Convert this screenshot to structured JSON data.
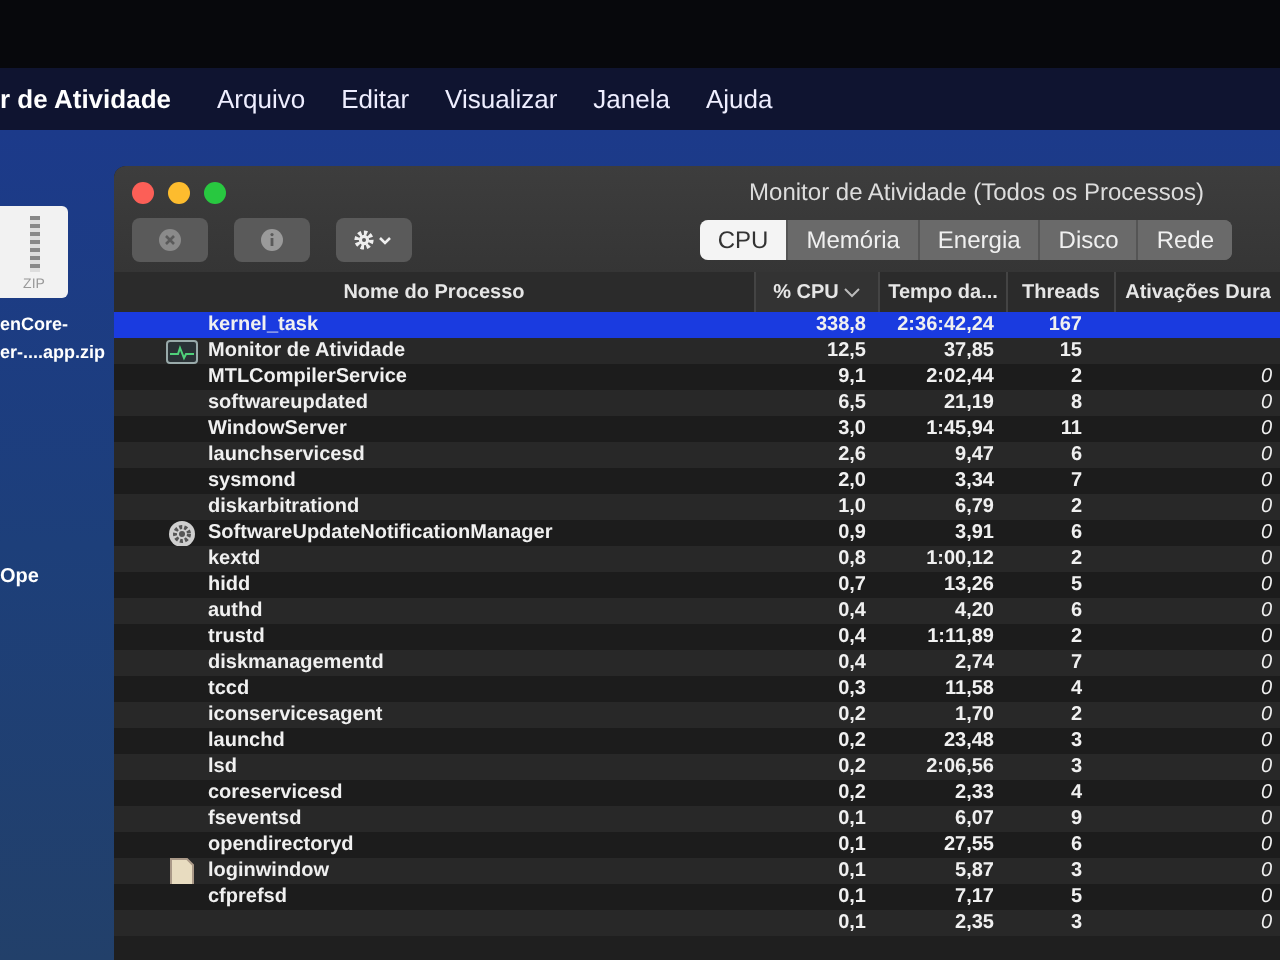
{
  "menu_bar": {
    "app_name": "r de Atividade",
    "items": [
      "Arquivo",
      "Editar",
      "Visualizar",
      "Janela",
      "Ajuda"
    ]
  },
  "desktop": {
    "file": {
      "badge": "ZIP",
      "name_lines": [
        "enCore-",
        "er-....app.zip"
      ]
    },
    "label": "Ope"
  },
  "window": {
    "title": "Monitor de Atividade (Todos os Processos)",
    "tabs": [
      {
        "label": "CPU",
        "selected": true
      },
      {
        "label": "Memória",
        "selected": false
      },
      {
        "label": "Energia",
        "selected": false
      },
      {
        "label": "Disco",
        "selected": false
      },
      {
        "label": "Rede",
        "selected": false
      }
    ],
    "columns": [
      {
        "label": "Nome do Processo",
        "sorted": false
      },
      {
        "label": "% CPU",
        "sorted": true
      },
      {
        "label": "Tempo da...",
        "sorted": false
      },
      {
        "label": "Threads",
        "sorted": false
      },
      {
        "label": "Ativações Dura",
        "sorted": false
      }
    ],
    "processes": [
      {
        "name": "kernel_task",
        "kind": "process",
        "cpu": "338,8",
        "time": "2:36:42,24",
        "threads": "167",
        "selected": true
      },
      {
        "name": "Monitor de Atividade",
        "kind": "app",
        "cpu": "12,5",
        "time": "37,85",
        "threads": "15",
        "selected": false
      },
      {
        "name": "MTLCompilerService",
        "kind": "process",
        "cpu": "9,1",
        "time": "2:02,44",
        "threads": "2",
        "wakeups": "0",
        "selected": false
      },
      {
        "name": "softwareupdated",
        "kind": "process",
        "cpu": "6,5",
        "time": "21,19",
        "threads": "8",
        "wakeups": "0",
        "selected": false
      },
      {
        "name": "WindowServer",
        "kind": "process",
        "cpu": "3,0",
        "time": "1:45,94",
        "threads": "11",
        "wakeups": "0",
        "selected": false
      },
      {
        "name": "launchservicesd",
        "kind": "process",
        "cpu": "2,6",
        "time": "9,47",
        "threads": "6",
        "wakeups": "0",
        "selected": false
      },
      {
        "name": "sysmond",
        "kind": "process",
        "cpu": "2,0",
        "time": "3,34",
        "threads": "7",
        "wakeups": "0",
        "selected": false
      },
      {
        "name": "diskarbitrationd",
        "kind": "process",
        "cpu": "1,0",
        "time": "6,79",
        "threads": "2",
        "wakeups": "0",
        "selected": false
      },
      {
        "name": "SoftwareUpdateNotificationManager",
        "kind": "service",
        "cpu": "0,9",
        "time": "3,91",
        "threads": "6",
        "wakeups": "0",
        "selected": false
      },
      {
        "name": "kextd",
        "kind": "process",
        "cpu": "0,8",
        "time": "1:00,12",
        "threads": "2",
        "wakeups": "0",
        "selected": false
      },
      {
        "name": "hidd",
        "kind": "process",
        "cpu": "0,7",
        "time": "13,26",
        "threads": "5",
        "wakeups": "0",
        "selected": false
      },
      {
        "name": "authd",
        "kind": "process",
        "cpu": "0,4",
        "time": "4,20",
        "threads": "6",
        "wakeups": "0",
        "selected": false
      },
      {
        "name": "trustd",
        "kind": "process",
        "cpu": "0,4",
        "time": "1:11,89",
        "threads": "2",
        "wakeups": "0",
        "selected": false
      },
      {
        "name": "diskmanagementd",
        "kind": "process",
        "cpu": "0,4",
        "time": "2,74",
        "threads": "7",
        "wakeups": "0",
        "selected": false
      },
      {
        "name": "tccd",
        "kind": "process",
        "cpu": "0,3",
        "time": "11,58",
        "threads": "4",
        "wakeups": "0",
        "selected": false
      },
      {
        "name": "iconservicesagent",
        "kind": "process",
        "cpu": "0,2",
        "time": "1,70",
        "threads": "2",
        "wakeups": "0",
        "selected": false
      },
      {
        "name": "launchd",
        "kind": "process",
        "cpu": "0,2",
        "time": "23,48",
        "threads": "3",
        "wakeups": "0",
        "selected": false
      },
      {
        "name": "lsd",
        "kind": "process",
        "cpu": "0,2",
        "time": "2:06,56",
        "threads": "3",
        "wakeups": "0",
        "selected": false
      },
      {
        "name": "coreservicesd",
        "kind": "process",
        "cpu": "0,2",
        "time": "2,33",
        "threads": "4",
        "wakeups": "0",
        "selected": false
      },
      {
        "name": "fseventsd",
        "kind": "process",
        "cpu": "0,1",
        "time": "6,07",
        "threads": "9",
        "wakeups": "0",
        "selected": false
      },
      {
        "name": "opendirectoryd",
        "kind": "process",
        "cpu": "0,1",
        "time": "27,55",
        "threads": "6",
        "wakeups": "0",
        "selected": false
      },
      {
        "name": "loginwindow",
        "kind": "session",
        "cpu": "0,1",
        "time": "5,87",
        "threads": "3",
        "wakeups": "0",
        "selected": false
      },
      {
        "name": "cfprefsd",
        "kind": "process",
        "cpu": "0,1",
        "time": "7,17",
        "threads": "5",
        "wakeups": "0",
        "selected": false
      },
      {
        "kind": "process",
        "cpu": "0,1",
        "time": "2,35",
        "threads": "3",
        "wakeups": "0",
        "selected": false
      }
    ]
  }
}
